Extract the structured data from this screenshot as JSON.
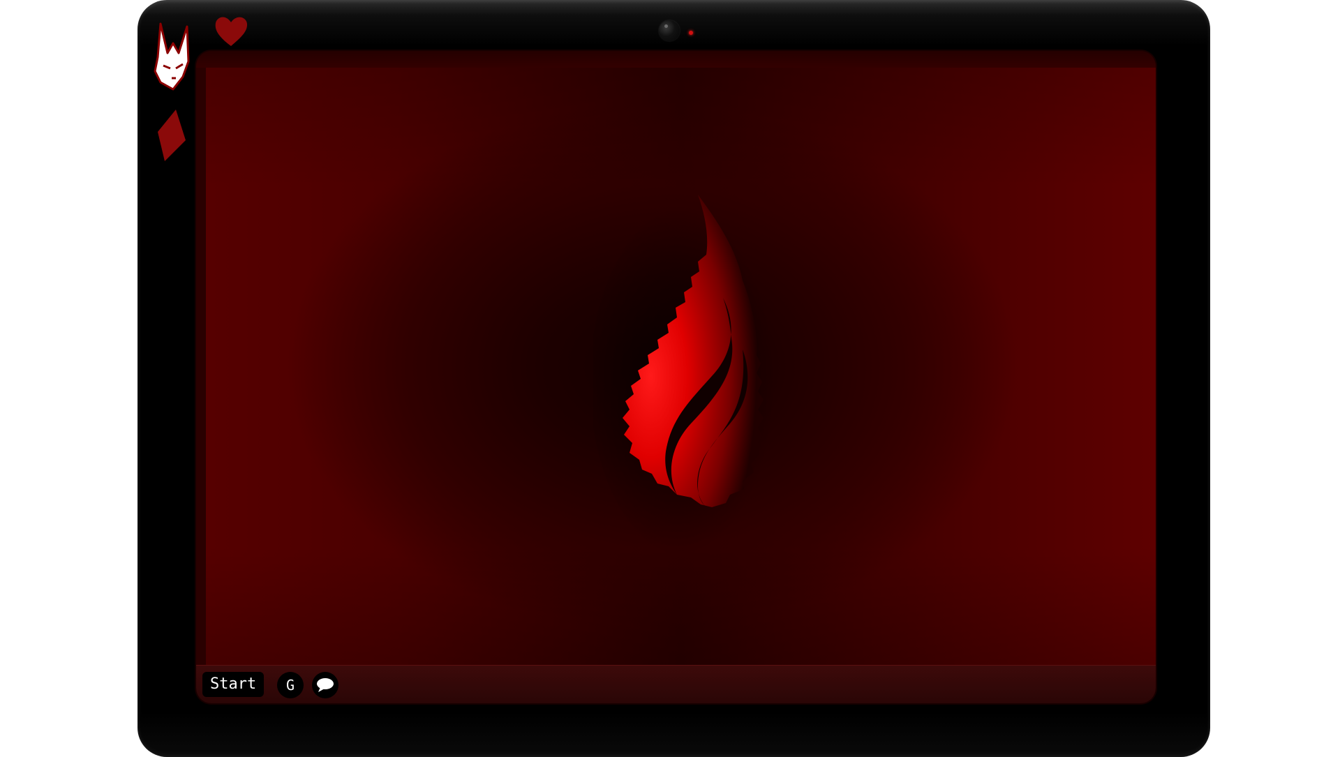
{
  "device": {
    "frame_color": "#000000",
    "led_color": "#d01010"
  },
  "side_icons": [
    "bunny-icon",
    "heart-icon",
    "diamond-icon"
  ],
  "screen": {
    "wallpaper_colors": [
      "#5e0000",
      "#140000"
    ],
    "center_logo": "flame-logo"
  },
  "taskbar": {
    "start_label": "Start",
    "g_label": "G",
    "chat_icon": "speech-bubble-icon"
  }
}
